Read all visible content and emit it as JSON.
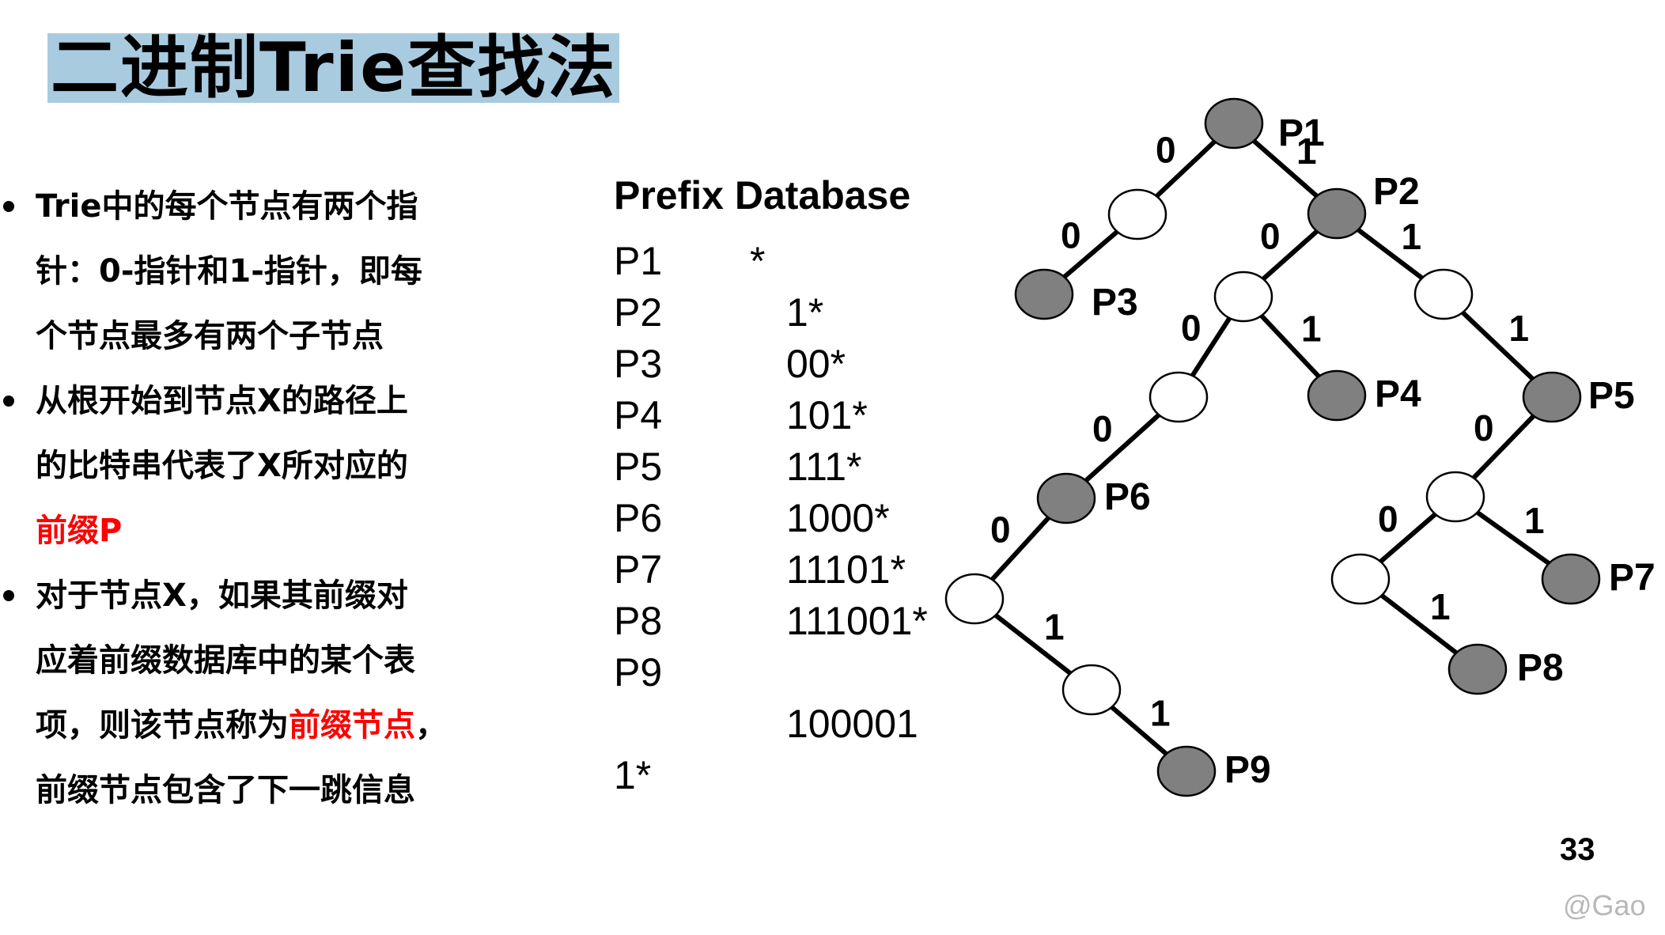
{
  "slide": {
    "title": "二进制Trie查找法",
    "page_number": "33",
    "watermark": "@Gao"
  },
  "bullets": [
    {
      "lines": [
        [
          {
            "text": "Trie中的每个节点有两个指"
          }
        ],
        [
          {
            "text": "针：0-指针和1-指针，即每"
          }
        ],
        [
          {
            "text": "个节点最多有两个子节点"
          }
        ]
      ]
    },
    {
      "lines": [
        [
          {
            "text": "从根开始到节点X的路径上"
          }
        ],
        [
          {
            "text": "的比特串代表了X所对应的"
          }
        ],
        [
          {
            "text": "前缀P",
            "highlight": true
          }
        ]
      ]
    },
    {
      "lines": [
        [
          {
            "text": "对于节点X，如果其前缀对"
          }
        ],
        [
          {
            "text": "应着前缀数据库中的某个表"
          }
        ],
        [
          {
            "text": "项，则该节点称为"
          },
          {
            "text": "前缀节点",
            "highlight": true
          },
          {
            "text": "，"
          }
        ],
        [
          {
            "text": "前缀节点包含了下一跳信息"
          }
        ]
      ]
    }
  ],
  "prefix_database": {
    "title": "Prefix Database",
    "entries": [
      {
        "name": "P1",
        "prefix": "*"
      },
      {
        "name": "P2",
        "prefix": "1*"
      },
      {
        "name": "P3",
        "prefix": "00*"
      },
      {
        "name": "P4",
        "prefix": "101*"
      },
      {
        "name": "P5",
        "prefix": "111*"
      },
      {
        "name": "P6",
        "prefix": "1000*"
      },
      {
        "name": "P7",
        "prefix": "11101*"
      },
      {
        "name": "P8",
        "prefix": "111001*"
      },
      {
        "name": "P9",
        "prefix": "100001",
        "prefix_tail": "1*"
      }
    ]
  },
  "trie": {
    "colors": {
      "prefix_node": "#808080",
      "empty_node": "#ffffff",
      "edge": "#000000"
    },
    "nodes": [
      {
        "id": "root",
        "label": "P1",
        "prefix_node": true
      },
      {
        "id": "n0",
        "label": "",
        "prefix_node": false
      },
      {
        "id": "n00",
        "label": "P3",
        "prefix_node": true
      },
      {
        "id": "n1",
        "label": "P2",
        "prefix_node": true
      },
      {
        "id": "n10",
        "label": "",
        "prefix_node": false
      },
      {
        "id": "n11",
        "label": "",
        "prefix_node": false
      },
      {
        "id": "n100",
        "label": "",
        "prefix_node": false
      },
      {
        "id": "n101",
        "label": "P4",
        "prefix_node": true
      },
      {
        "id": "n111",
        "label": "P5",
        "prefix_node": true
      },
      {
        "id": "n1000",
        "label": "P6",
        "prefix_node": true
      },
      {
        "id": "n1110",
        "label": "",
        "prefix_node": false
      },
      {
        "id": "n10000",
        "label": "",
        "prefix_node": false
      },
      {
        "id": "n11100",
        "label": "",
        "prefix_node": false
      },
      {
        "id": "n11101",
        "label": "P7",
        "prefix_node": true
      },
      {
        "id": "n100001",
        "label": "",
        "prefix_node": false
      },
      {
        "id": "n111001",
        "label": "P8",
        "prefix_node": true
      },
      {
        "id": "n1000011",
        "label": "P9",
        "prefix_node": true
      }
    ],
    "edges": [
      {
        "from": "root",
        "to": "n0",
        "bit": "0"
      },
      {
        "from": "root",
        "to": "n1",
        "bit": "1"
      },
      {
        "from": "n0",
        "to": "n00",
        "bit": "0"
      },
      {
        "from": "n1",
        "to": "n10",
        "bit": "0"
      },
      {
        "from": "n1",
        "to": "n11",
        "bit": "1"
      },
      {
        "from": "n10",
        "to": "n100",
        "bit": "0"
      },
      {
        "from": "n10",
        "to": "n101",
        "bit": "1"
      },
      {
        "from": "n11",
        "to": "n111",
        "bit": "1"
      },
      {
        "from": "n100",
        "to": "n1000",
        "bit": "0"
      },
      {
        "from": "n111",
        "to": "n1110",
        "bit": "0"
      },
      {
        "from": "n1000",
        "to": "n10000",
        "bit": "0"
      },
      {
        "from": "n1110",
        "to": "n11100",
        "bit": "0"
      },
      {
        "from": "n1110",
        "to": "n11101",
        "bit": "1"
      },
      {
        "from": "n10000",
        "to": "n100001",
        "bit": "1"
      },
      {
        "from": "n11100",
        "to": "n111001",
        "bit": "1"
      },
      {
        "from": "n100001",
        "to": "n1000011",
        "bit": "1"
      }
    ]
  }
}
